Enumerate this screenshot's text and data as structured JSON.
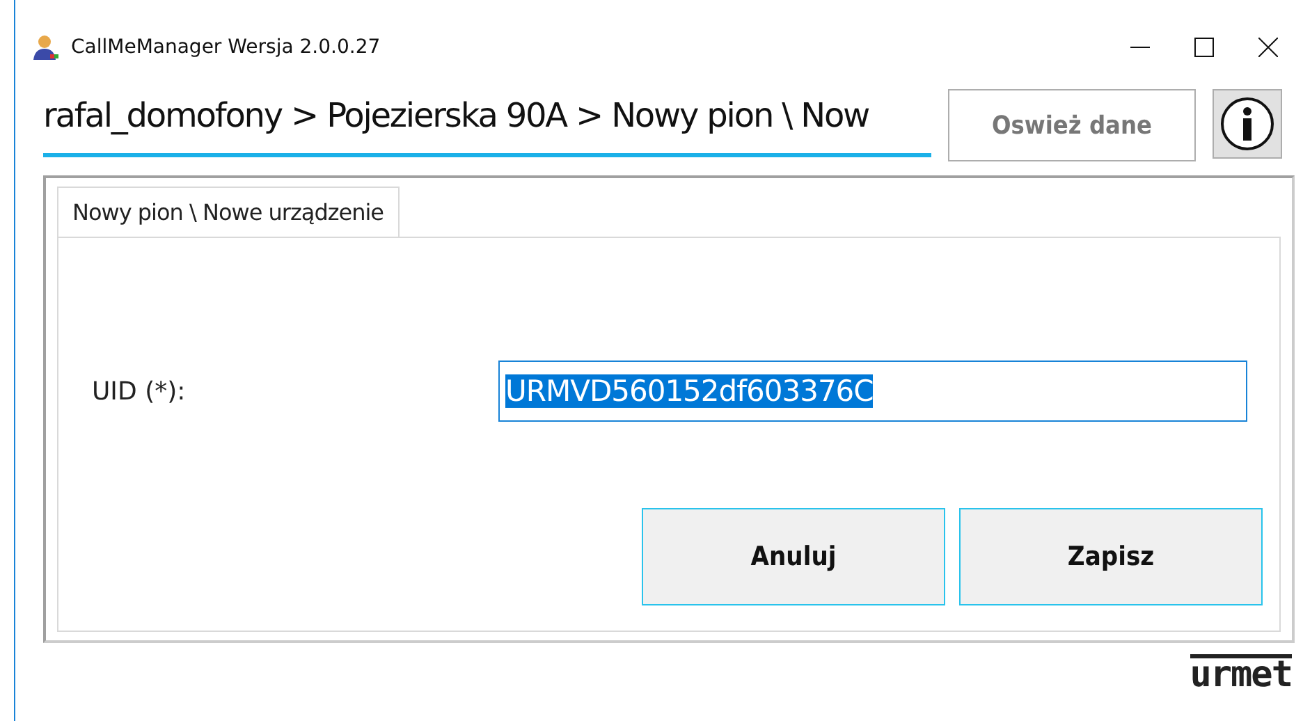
{
  "window": {
    "title": "CallMeManager Wersja 2.0.0.27"
  },
  "breadcrumb": "rafal_domofony > Pojezierska 90A > Nowy pion \\ Now",
  "refresh_button": "Oswież dane",
  "tabs": [
    {
      "label": "Nowy pion \\ Nowe urządzenie",
      "selected": true
    }
  ],
  "form": {
    "uid_label": "UID (*):",
    "uid_value": "URMVD560152df603376C",
    "uid_selected": true
  },
  "buttons": [
    "Anuluj",
    "Zapisz"
  ],
  "logo": "urmet"
}
